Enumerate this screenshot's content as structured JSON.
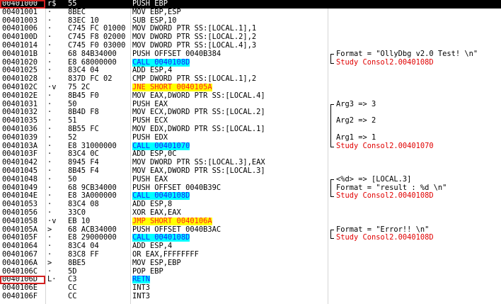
{
  "rows": [
    {
      "addr": "00401000",
      "mark": "r$",
      "hex": "55",
      "disasm": "PUSH EBP",
      "comment": "",
      "style": "sel"
    },
    {
      "addr": "00401001",
      "mark": "·",
      "hex": "8BEC",
      "disasm": "MOV EBP,ESP",
      "comment": ""
    },
    {
      "addr": "00401003",
      "mark": "·",
      "hex": "83EC 10",
      "disasm": "SUB ESP,10",
      "comment": ""
    },
    {
      "addr": "00401006",
      "mark": "·",
      "hex": "C745 FC 01000",
      "disasm": "MOV DWORD PTR SS:[LOCAL.1],1",
      "comment": ""
    },
    {
      "addr": "0040100D",
      "mark": "·",
      "hex": "C745 F8 02000",
      "disasm": "MOV DWORD PTR SS:[LOCAL.2],2",
      "comment": ""
    },
    {
      "addr": "00401014",
      "mark": "·",
      "hex": "C745 F0 03000",
      "disasm": "MOV DWORD PTR SS:[LOCAL.4],3",
      "comment": ""
    },
    {
      "addr": "0040101B",
      "mark": "·",
      "hex": "68 84B34000",
      "disasm": "PUSH OFFSET 0040B384",
      "comment": "Format = \"OllyDbg v2.0 Test! \\n\""
    },
    {
      "addr": "00401020",
      "mark": "·",
      "hex": "E8 68000000",
      "disasm": "CALL 0040108D",
      "comment": "Study Consol2.0040108D",
      "style": "call"
    },
    {
      "addr": "00401025",
      "mark": "·",
      "hex": "83C4 04",
      "disasm": "ADD ESP,4",
      "comment": ""
    },
    {
      "addr": "00401028",
      "mark": "·",
      "hex": "837D FC 02",
      "disasm": "CMP DWORD PTR SS:[LOCAL.1],2",
      "comment": ""
    },
    {
      "addr": "0040102C",
      "mark": "·v",
      "hex": "75 2C",
      "disasm": "JNE SHORT 0040105A",
      "comment": "",
      "style": "jmp"
    },
    {
      "addr": "0040102E",
      "mark": "·",
      "hex": "8B45 F0",
      "disasm": "MOV EAX,DWORD PTR SS:[LOCAL.4]",
      "comment": ""
    },
    {
      "addr": "00401031",
      "mark": "·",
      "hex": "50",
      "disasm": "PUSH EAX",
      "comment": "Arg3 => 3"
    },
    {
      "addr": "00401032",
      "mark": "·",
      "hex": "8B4D F8",
      "disasm": "MOV ECX,DWORD PTR SS:[LOCAL.2]",
      "comment": ""
    },
    {
      "addr": "00401035",
      "mark": "·",
      "hex": "51",
      "disasm": "PUSH ECX",
      "comment": "Arg2 => 2"
    },
    {
      "addr": "00401036",
      "mark": "·",
      "hex": "8B55 FC",
      "disasm": "MOV EDX,DWORD PTR SS:[LOCAL.1]",
      "comment": ""
    },
    {
      "addr": "00401039",
      "mark": "·",
      "hex": "52",
      "disasm": "PUSH EDX",
      "comment": "Arg1 => 1"
    },
    {
      "addr": "0040103A",
      "mark": "·",
      "hex": "E8 31000000",
      "disasm": "CALL 00401070",
      "comment": "Study Consol2.00401070",
      "style": "call"
    },
    {
      "addr": "0040103F",
      "mark": "·",
      "hex": "83C4 0C",
      "disasm": "ADD ESP,0C",
      "comment": ""
    },
    {
      "addr": "00401042",
      "mark": "·",
      "hex": "8945 F4",
      "disasm": "MOV DWORD PTR SS:[LOCAL.3],EAX",
      "comment": ""
    },
    {
      "addr": "00401045",
      "mark": "·",
      "hex": "8B45 F4",
      "disasm": "MOV EAX,DWORD PTR SS:[LOCAL.3]",
      "comment": ""
    },
    {
      "addr": "00401048",
      "mark": "·",
      "hex": "50",
      "disasm": "PUSH EAX",
      "comment": "<%d> => [LOCAL.3]"
    },
    {
      "addr": "00401049",
      "mark": "·",
      "hex": "68 9CB34000",
      "disasm": "PUSH OFFSET 0040B39C",
      "comment": "Format = \"result : %d \\n\""
    },
    {
      "addr": "0040104E",
      "mark": "·",
      "hex": "E8 3A000000",
      "disasm": "CALL 0040108D",
      "comment": "Study Consol2.0040108D",
      "style": "call"
    },
    {
      "addr": "00401053",
      "mark": "·",
      "hex": "83C4 08",
      "disasm": "ADD ESP,8",
      "comment": ""
    },
    {
      "addr": "00401056",
      "mark": "·",
      "hex": "33C0",
      "disasm": "XOR EAX,EAX",
      "comment": ""
    },
    {
      "addr": "00401058",
      "mark": "·v",
      "hex": "EB 10",
      "disasm": "JMP SHORT 0040106A",
      "comment": "",
      "style": "jmp"
    },
    {
      "addr": "0040105A",
      "mark": ">",
      "hex": "68 ACB34000",
      "disasm": "PUSH OFFSET 0040B3AC",
      "comment": "Format = \"Error!! \\n\""
    },
    {
      "addr": "0040105F",
      "mark": "·",
      "hex": "E8 29000000",
      "disasm": "CALL 0040108D",
      "comment": "Study Consol2.0040108D",
      "style": "call"
    },
    {
      "addr": "00401064",
      "mark": "·",
      "hex": "83C4 04",
      "disasm": "ADD ESP,4",
      "comment": ""
    },
    {
      "addr": "00401067",
      "mark": "·",
      "hex": "83C8 FF",
      "disasm": "OR EAX,FFFFFFFF",
      "comment": ""
    },
    {
      "addr": "0040106A",
      "mark": ">",
      "hex": "8BE5",
      "disasm": "MOV ESP,EBP",
      "comment": ""
    },
    {
      "addr": "0040106C",
      "mark": "·",
      "hex": "5D",
      "disasm": "POP EBP",
      "comment": ""
    },
    {
      "addr": "0040106D",
      "mark": "L·",
      "hex": "C3",
      "disasm": "RETN",
      "comment": "",
      "style": "ret"
    },
    {
      "addr": "0040106E",
      "mark": "",
      "hex": "CC",
      "disasm": "INT3",
      "comment": ""
    },
    {
      "addr": "0040106F",
      "mark": "",
      "hex": "CC",
      "disasm": "INT3",
      "comment": ""
    }
  ],
  "colors": {
    "selection_bg": "#000000",
    "call_bg": "#00ffff",
    "jump_bg": "#ffff00",
    "comment_red": "#e00000",
    "box_red": "#d42020"
  }
}
